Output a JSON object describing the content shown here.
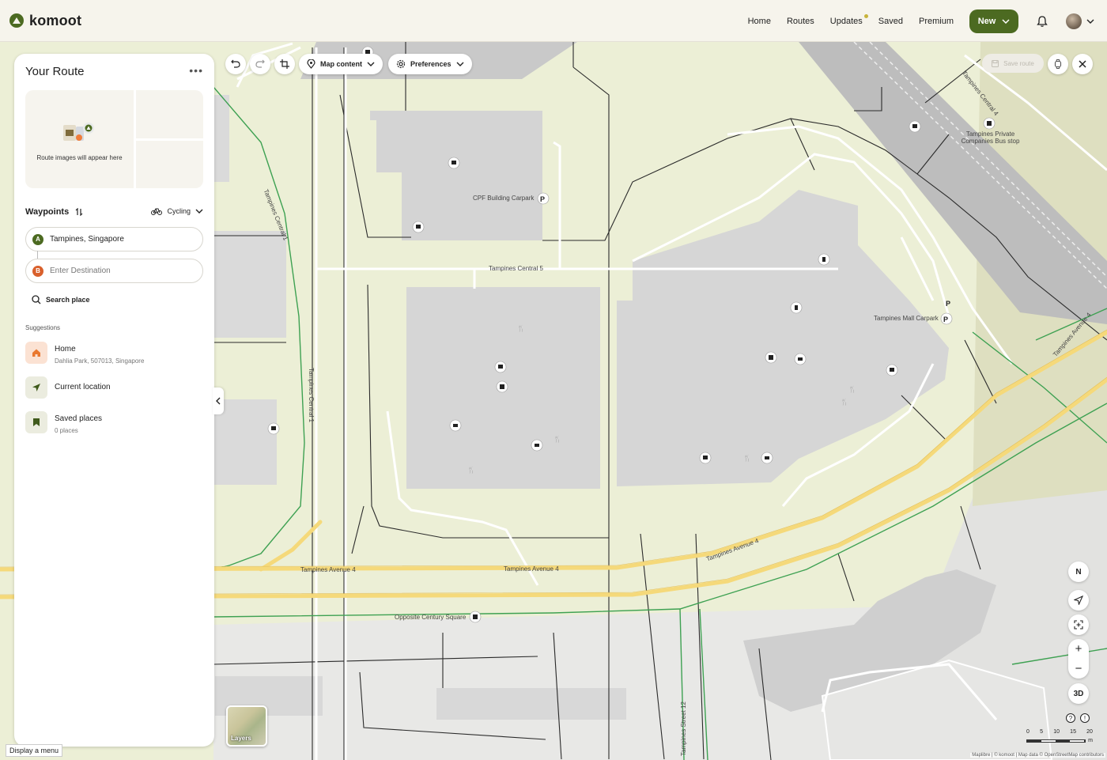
{
  "app": {
    "logo_text": "komoot",
    "nav": [
      "Home",
      "Routes",
      "Updates",
      "Saved",
      "Premium"
    ],
    "new_button": "New",
    "accent_color": "#4c6a21"
  },
  "panel": {
    "title": "Your Route",
    "route_images_caption": "Route images will appear here",
    "waypoints_label": "Waypoints",
    "sport": "Cycling",
    "waypoint_a": {
      "badge": "A",
      "value": "Tampines, Singapore"
    },
    "waypoint_b": {
      "badge": "B",
      "placeholder": "Enter Destination"
    },
    "search_place": "Search place",
    "suggestions_title": "Suggestions",
    "suggestions": [
      {
        "label": "Home",
        "sub": "Dahlia Park, 507013, Singapore",
        "icon": "home-icon"
      },
      {
        "label": "Current location",
        "sub": "",
        "icon": "navigation-arrow-icon"
      },
      {
        "label": "Saved places",
        "sub": "0 places",
        "icon": "bookmark-icon"
      }
    ]
  },
  "toolbar": {
    "map_content": "Map content",
    "preferences": "Preferences",
    "save_route": "Save route"
  },
  "map": {
    "labels": [
      "Tampines Central 1",
      "CPF Building Carpark",
      "Tampines Central 5",
      "Tampines Central 4",
      "Tampines Private Companies Bus stop",
      "Tampines Mall Carpark",
      "Tampines Avenue 4",
      "Tampines Avenue 4",
      "Tampines Avenue 4",
      "Tampines Avenue 4",
      "Opposite Century Square",
      "Tampines Street 12",
      "Tampines Central 1"
    ],
    "compass": "N",
    "three_d": "3D",
    "zoom_in": "+",
    "zoom_out": "−",
    "scale_ticks": [
      "0",
      "5",
      "10",
      "15",
      "20"
    ],
    "scale_unit": "m",
    "attribution": "Maplibre | © komoot | Map data © OpenStreetMap contributors",
    "layers_label": "Layers"
  },
  "tooltip": "Display a menu"
}
